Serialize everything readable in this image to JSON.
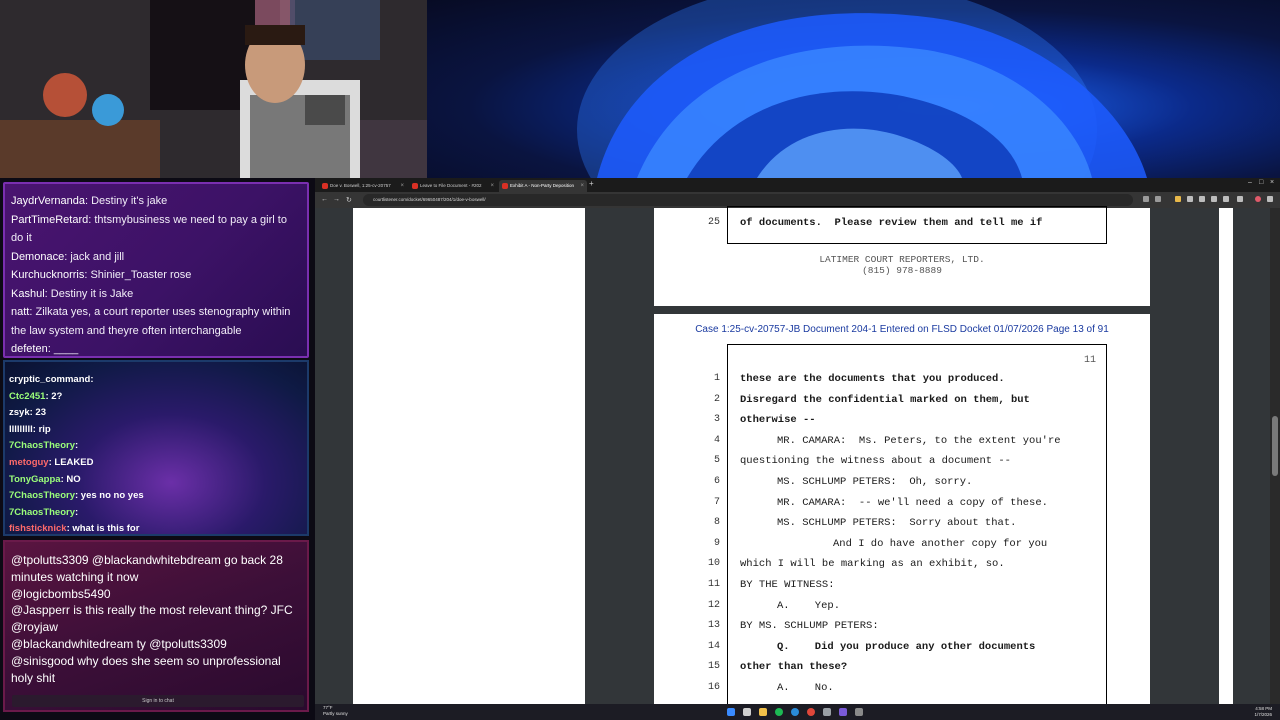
{
  "chat_top": [
    {
      "user": "JaydrVernanda",
      "text": ": Destiny it's jake"
    },
    {
      "user": "PartTimeRetard",
      "text": ": thtsmybusiness we need to pay a girl to"
    },
    {
      "user": "",
      "text": "do it"
    },
    {
      "user": "Demonace",
      "text": ": jack and jill"
    },
    {
      "user": "Kurchucknorris",
      "text": ": Shinier_Toaster rose"
    },
    {
      "user": "Kashul",
      "text": ": Destiny it is Jake"
    },
    {
      "user": "natt",
      "text": ": Zilkata yes, a court reporter uses stenography within"
    },
    {
      "user": "",
      "text": "the law system and theyre often interchangable"
    },
    {
      "user": "defeten",
      "text": ": ____"
    }
  ],
  "chat_mid": [
    {
      "user": "cryptic_command",
      "text": ":",
      "color": "#ffffff"
    },
    {
      "user": "Ctc2451",
      "text": ": 2?",
      "color": "#9bff7a"
    },
    {
      "user": "zsyk",
      "text": ": 23",
      "color": "#ffffff"
    },
    {
      "user": "lllllllll",
      "text": ": rip",
      "color": "#ffffff"
    },
    {
      "user": "7ChaosTheory",
      "text": ":",
      "color": "#9bff7a"
    },
    {
      "user": "metoguy",
      "text": ": LEAKED",
      "color": "#ff6a6a"
    },
    {
      "user": "TonyGappa",
      "text": ": NO",
      "color": "#9bff7a"
    },
    {
      "user": "7ChaosTheory",
      "text": ": yes no  no yes",
      "color": "#9bff7a"
    },
    {
      "user": "7ChaosTheory",
      "text": ":",
      "color": "#9bff7a"
    },
    {
      "user": "fishsticknick",
      "text": ": what is this for",
      "color": "#ff6a6a"
    }
  ],
  "chat_bottom": [
    "@tpolutts3309 @blackandwhitebdream go back 28 minutes watching it now",
    "@logicbombs5490",
    "@Jaspperr is this really the most relevant thing? JFC",
    "@royjaw",
    "@blackandwhitedream ty @tpolutts3309",
    "@sinisgood why does she seem so unprofessional holy shit"
  ],
  "signin_label": "Sign in to chat",
  "browser": {
    "tabs": [
      "Doe v. Boswell, 1:25-cv-20757",
      "Leave to File Document - #202",
      "Exhibit A - Non-Party Deposition"
    ],
    "new_tab": "+",
    "url": "courtlistener.com/docket/69650487/204/1/doe-v-boswell/",
    "window_controls": [
      "–",
      "□",
      "×"
    ]
  },
  "page1": {
    "line_num": "25",
    "line_text": "of documents.  Please review them and tell me if",
    "reporter": "LATIMER COURT REPORTERS, LTD.",
    "phone": "(815) 978-8889"
  },
  "page2": {
    "header": "Case 1:25-cv-20757-JB   Document 204-1   Entered on FLSD Docket 01/07/2026   Page 13 of 91",
    "page_no": "11",
    "lines": [
      {
        "n": "1",
        "t": "these are the documents that you produced.",
        "bold": true,
        "indent": 0
      },
      {
        "n": "2",
        "t": "Disregard the confidential marked on them, but",
        "bold": true,
        "indent": 0
      },
      {
        "n": "3",
        "t": "otherwise --",
        "bold": true,
        "indent": 0
      },
      {
        "n": "4",
        "t": "MR. CAMARA:  Ms. Peters, to the extent you're",
        "bold": false,
        "indent": 1
      },
      {
        "n": "5",
        "t": "questioning the witness about a document --",
        "bold": false,
        "indent": 0
      },
      {
        "n": "6",
        "t": "MS. SCHLUMP PETERS:  Oh, sorry.",
        "bold": false,
        "indent": 1
      },
      {
        "n": "7",
        "t": "MR. CAMARA:  -- we'll need a copy of these.",
        "bold": false,
        "indent": 1
      },
      {
        "n": "8",
        "t": "MS. SCHLUMP PETERS:  Sorry about that.",
        "bold": false,
        "indent": 1
      },
      {
        "n": "9",
        "t": "And I do have another copy for you",
        "bold": false,
        "indent": 2
      },
      {
        "n": "10",
        "t": "which I will be marking as an exhibit, so.",
        "bold": false,
        "indent": 0
      },
      {
        "n": "11",
        "t": "BY THE WITNESS:",
        "bold": false,
        "indent": 0
      },
      {
        "n": "12",
        "t": "A.    Yep.",
        "bold": false,
        "indent": 1
      },
      {
        "n": "13",
        "t": "BY MS. SCHLUMP PETERS:",
        "bold": false,
        "indent": 0
      },
      {
        "n": "14",
        "t": "Q.    Did you produce any other documents",
        "bold": true,
        "indent": 1
      },
      {
        "n": "15",
        "t": "other than these?",
        "bold": true,
        "indent": 0
      },
      {
        "n": "16",
        "t": "A.    No.",
        "bold": false,
        "indent": 1
      }
    ]
  },
  "taskbar": {
    "weather_temp": "77°F",
    "weather_desc": "Partly sunny",
    "time": "4:58 PM",
    "date": "1/7/2026"
  },
  "colors": {
    "chat_a_bg": "#3c1266",
    "chat_c_bg": "#3c0f38",
    "pdf_header": "#1a3aa0"
  }
}
